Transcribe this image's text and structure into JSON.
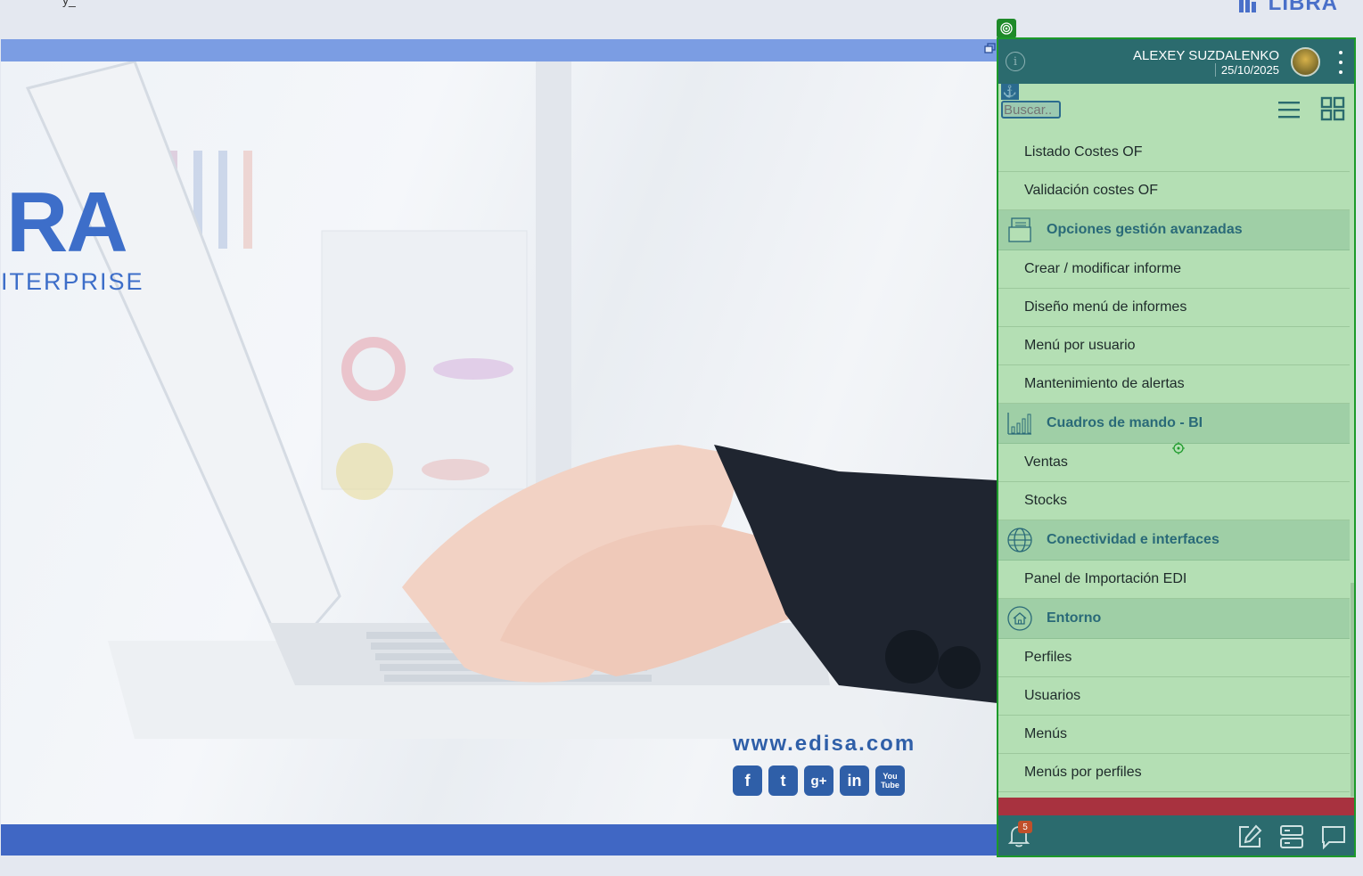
{
  "app": {
    "top_left_text": "y_",
    "top_logo": "LIBRA"
  },
  "background": {
    "brand_big": "RA",
    "brand_sub": "ITERPRISE",
    "site_url": "www.edisa.com",
    "social": [
      {
        "name": "facebook",
        "glyph": "f"
      },
      {
        "name": "twitter",
        "glyph": "t"
      },
      {
        "name": "google-plus",
        "glyph": "g+"
      },
      {
        "name": "linkedin",
        "glyph": "in"
      },
      {
        "name": "youtube",
        "glyph": "You Tube"
      }
    ]
  },
  "panel": {
    "user_name": "ALEXEY SUZDALENKO",
    "date": "25/10/2025",
    "search_placeholder": "Buscar..",
    "menu": [
      {
        "type": "item",
        "label": "Listado Costes OF"
      },
      {
        "type": "item",
        "label": "Validación costes OF"
      },
      {
        "type": "section",
        "label": "Opciones gestión avanzadas",
        "icon": "report-icon"
      },
      {
        "type": "item",
        "label": "Crear / modificar informe"
      },
      {
        "type": "item",
        "label": "Diseño menú de informes"
      },
      {
        "type": "item",
        "label": "Menú por usuario"
      },
      {
        "type": "item",
        "label": "Mantenimiento de alertas"
      },
      {
        "type": "section",
        "label": "Cuadros de mando - BI",
        "icon": "bar-chart-icon"
      },
      {
        "type": "item",
        "label": "Ventas"
      },
      {
        "type": "item",
        "label": "Stocks"
      },
      {
        "type": "section",
        "label": "Conectividad e interfaces",
        "icon": "globe-icon"
      },
      {
        "type": "item",
        "label": "Panel de Importación EDI"
      },
      {
        "type": "section",
        "label": "Entorno",
        "icon": "home-icon"
      },
      {
        "type": "item",
        "label": "Perfiles"
      },
      {
        "type": "item",
        "label": "Usuarios"
      },
      {
        "type": "item",
        "label": "Menús"
      },
      {
        "type": "item",
        "label": "Menús por perfiles"
      }
    ],
    "notifications_count": "5",
    "colors": {
      "header": "#2b6b6e",
      "panel_bg": "#b4dfb4",
      "section_bg": "#9fcfa6",
      "section_text": "#2a6a78",
      "alert_bar": "#a8323f"
    }
  }
}
